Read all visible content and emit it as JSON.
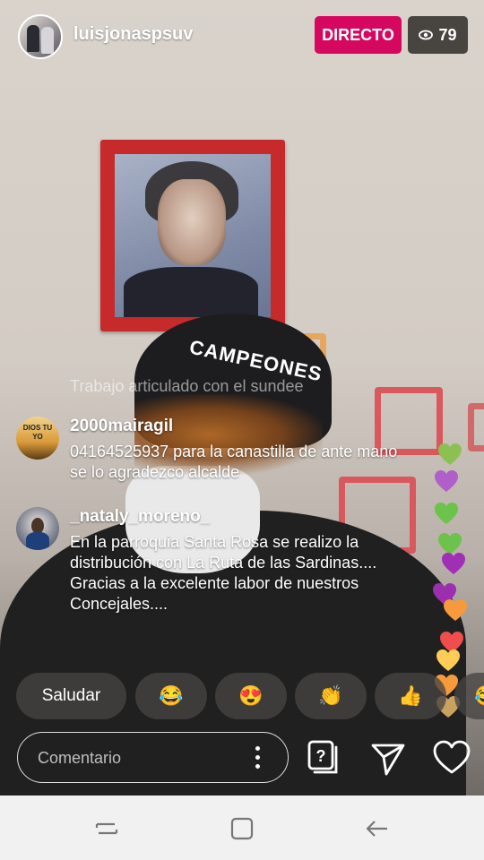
{
  "header": {
    "username": "luisjonaspsuv",
    "live_label": "DIRECTO",
    "viewer_count": "79"
  },
  "scene": {
    "cap_text": "CAMPEONES"
  },
  "comments": [
    {
      "user": "",
      "text": "Trabajo articulado con el sundee"
    },
    {
      "user": "2000mairagil",
      "text": "04164525937 para la canastilla de ante mano se lo agradezco alcalde"
    },
    {
      "user": "_nataly_moreno_",
      "text": "En la parroquia Santa Rosa se realizo la distribución con La Ruta de las Sardinas.... Gracias a la excelente labor de nuestros Concejales...."
    }
  ],
  "avatar_badge_text": "DIOS TU YO",
  "quick_reactions": {
    "greet_label": "Saludar",
    "emojis": [
      "😂",
      "😍",
      "👏",
      "👍",
      "😂"
    ]
  },
  "comment_input": {
    "placeholder": "Comentario"
  },
  "hearts": [
    "#8cc152",
    "#b05ec9",
    "#6cc24a",
    "#6cc24a",
    "#a02fb6",
    "#9b2fb0",
    "#f79a3c",
    "#f04d4d",
    "#ffcc55",
    "#f79a3c",
    "#c9a160"
  ]
}
